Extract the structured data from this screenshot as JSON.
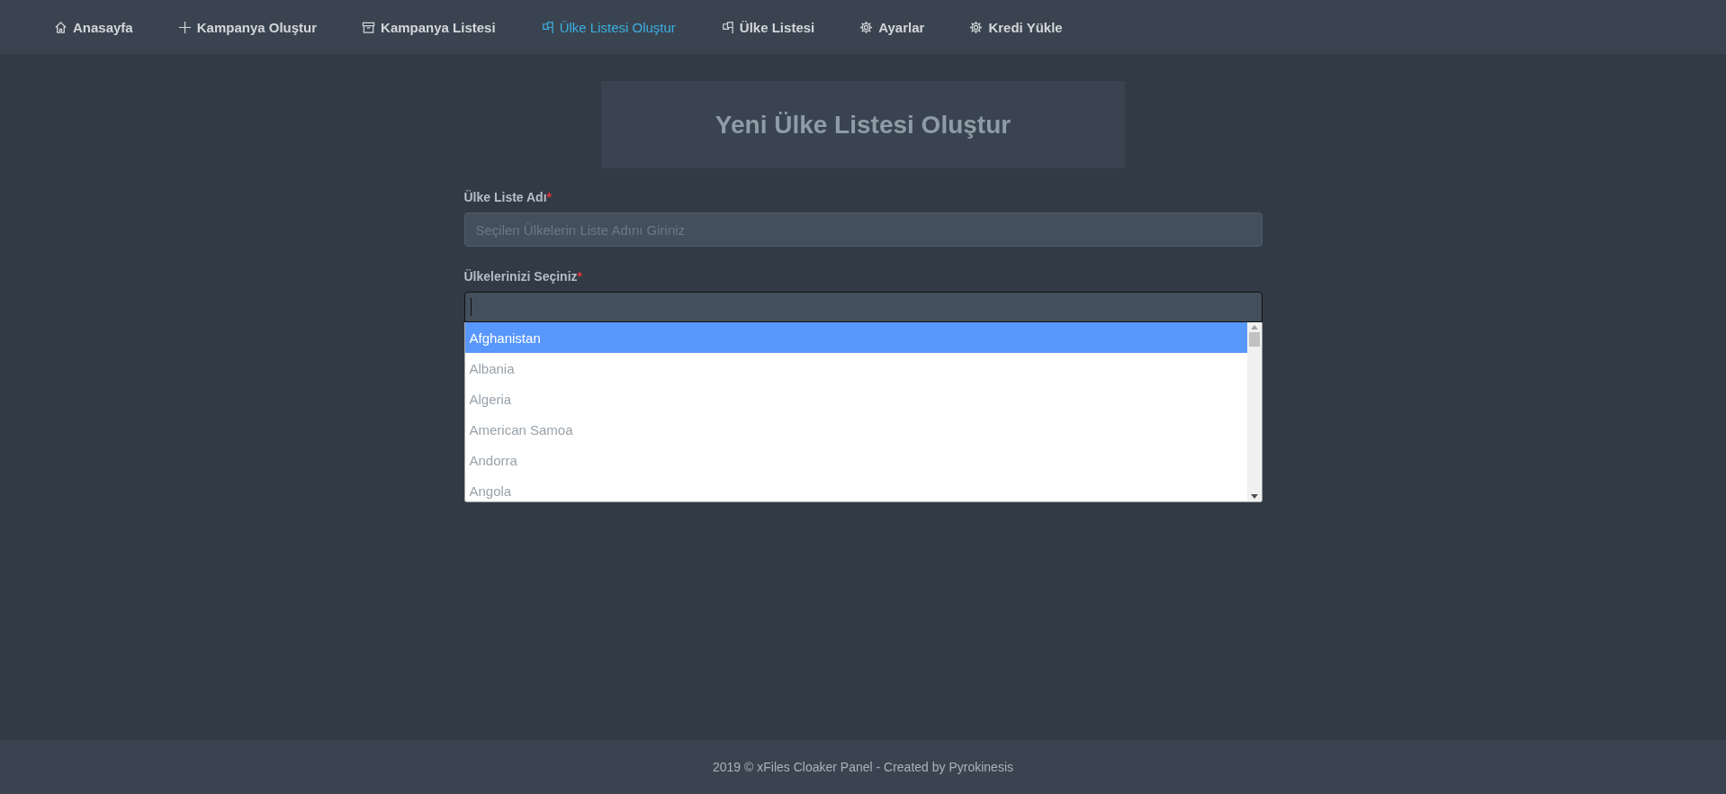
{
  "nav": [
    {
      "label": "Anasayfa",
      "kind": "home",
      "selected": false
    },
    {
      "label": "Kampanya Oluştur",
      "kind": "create",
      "selected": false
    },
    {
      "label": "Kampanya Listesi",
      "kind": "archive",
      "selected": false
    },
    {
      "label": "Ülke Listesi Oluştur",
      "kind": "flag",
      "selected": true
    },
    {
      "label": "Ülke Listesi",
      "kind": "flag",
      "selected": false
    },
    {
      "label": "Ayarlar",
      "kind": "settings",
      "selected": false
    },
    {
      "label": "Kredi Yükle",
      "kind": "settings",
      "selected": false
    }
  ],
  "page_title": "Yeni Ülke Listesi Oluştur",
  "form": {
    "name_label": "Ülke Liste Adı",
    "name_required": "*",
    "name_placeholder": "Seçilen Ülkelerin Liste Adını Giriniz",
    "countries_label": "Ülkelerinizi Seçiniz",
    "countries_required": "*",
    "options": [
      {
        "label": "Afghanistan",
        "selected": true
      },
      {
        "label": "Albania",
        "selected": false
      },
      {
        "label": "Algeria",
        "selected": false
      },
      {
        "label": "American Samoa",
        "selected": false
      },
      {
        "label": "Andorra",
        "selected": false
      },
      {
        "label": "Angola",
        "selected": false
      }
    ]
  },
  "footer": "2019 © xFiles Cloaker Panel - Created by Pyrokinesis"
}
